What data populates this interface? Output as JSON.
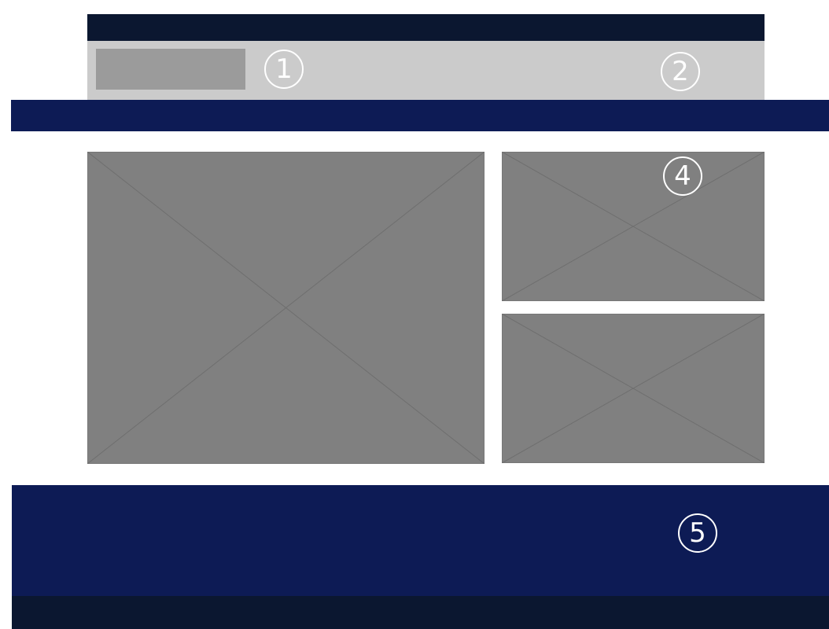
{
  "wireframe": {
    "colors": {
      "top_bar": "#0b1730",
      "header_band": "#cbcbcb",
      "logo_block": "#9b9b9b",
      "nav_band": "#0d1b55",
      "image_placeholder": "#808080",
      "placeholder_cross": "#6e6e6e",
      "footer_main": "#0d1b55",
      "footer_bottom": "#0b1730",
      "marker": "#ffffff"
    },
    "markers": {
      "logo_area": "1",
      "header_right": "2",
      "side_top_image": "4",
      "footer": "5"
    },
    "placeholders": [
      {
        "role": "main-image",
        "icon": "image-placeholder-cross"
      },
      {
        "role": "side-image-top",
        "icon": "image-placeholder-cross"
      },
      {
        "role": "side-image-bottom",
        "icon": "image-placeholder-cross"
      }
    ]
  }
}
